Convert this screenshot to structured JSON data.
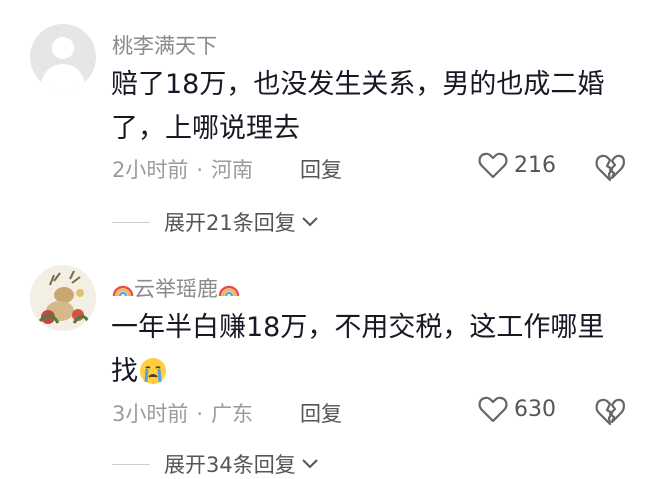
{
  "comments": [
    {
      "username": "桃李满天下",
      "text": "赔了18万，也没发生关系，男的也成二婚了，上哪说理去",
      "time": "2小时前",
      "location": "河南",
      "reply_label": "回复",
      "likes": "216",
      "expand_label": "展开21条回复"
    },
    {
      "username": "云举瑶鹿",
      "text": "一年半白赚18万，不用交税，这工作哪里找",
      "time": "3小时前",
      "location": "广东",
      "reply_label": "回复",
      "likes": "630",
      "expand_label": "展开34条回复"
    }
  ],
  "separator": "·",
  "icons": {
    "default_avatar": "default-avatar-icon",
    "heart": "heart-outline-icon",
    "dislike": "broken-heart-icon",
    "chevron": "chevron-down-icon",
    "rainbow": "rainbow-emoji",
    "crying": "crying-face-emoji"
  }
}
